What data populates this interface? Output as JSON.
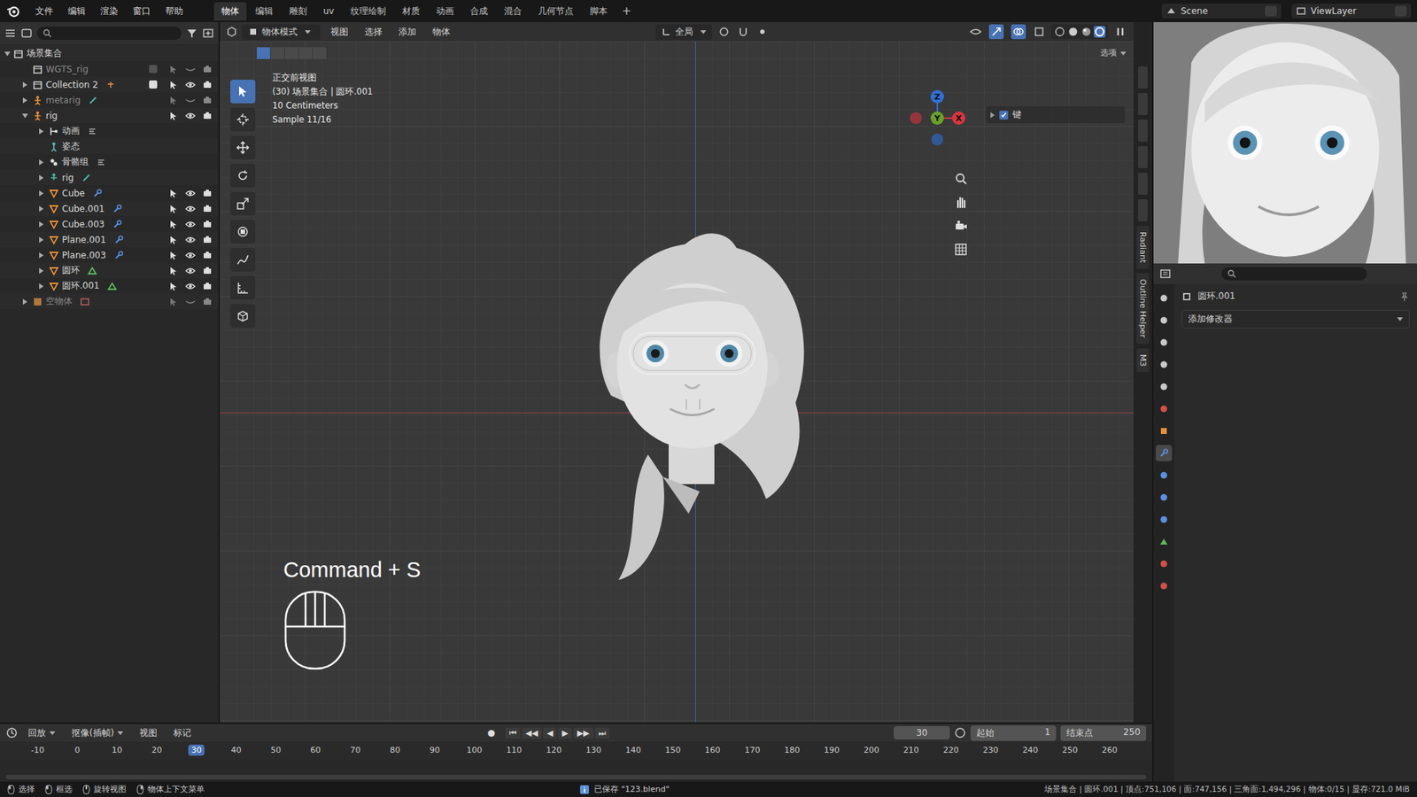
{
  "topbar": {
    "menus": [
      "文件",
      "编辑",
      "渲染",
      "窗口",
      "帮助"
    ],
    "workspaces": [
      {
        "label": "物体",
        "selected": true
      },
      {
        "label": "编辑",
        "selected": false
      },
      {
        "label": "雕刻",
        "selected": false
      },
      {
        "label": "uv",
        "selected": false
      },
      {
        "label": "纹理绘制",
        "selected": false
      },
      {
        "label": "材质",
        "selected": false
      },
      {
        "label": "动画",
        "selected": false
      },
      {
        "label": "合成",
        "selected": false
      },
      {
        "label": "混合",
        "selected": false
      },
      {
        "label": "几何节点",
        "selected": false
      },
      {
        "label": "脚本",
        "selected": false
      }
    ],
    "add_workspace": "+",
    "scene": "Scene",
    "view_layer": "ViewLayer"
  },
  "outliner": {
    "root": "场景集合",
    "items": [
      {
        "label": "WGTS_rig",
        "depth": 1,
        "has_children": false,
        "expanded": false,
        "kind": "collection",
        "disabled": true,
        "restrict": true,
        "visible": false,
        "checked": false,
        "sub_icon": "none"
      },
      {
        "label": "Collection 2",
        "depth": 1,
        "has_children": true,
        "expanded": false,
        "kind": "collection",
        "disabled": false,
        "restrict": true,
        "visible": true,
        "checked": true,
        "sub_icon": "armature"
      },
      {
        "label": "metarig",
        "depth": 1,
        "has_children": true,
        "expanded": false,
        "kind": "armature",
        "disabled": true,
        "restrict": true,
        "visible": false,
        "sub_icon": "bone"
      },
      {
        "label": "rig",
        "depth": 1,
        "has_children": true,
        "expanded": true,
        "kind": "armature",
        "disabled": false,
        "restrict": true,
        "visible": true,
        "sub_icon": "none"
      },
      {
        "label": "动画",
        "depth": 2,
        "has_children": true,
        "expanded": false,
        "kind": "anim",
        "disabled": false,
        "restrict": false,
        "visible": true,
        "sub_icon": "action"
      },
      {
        "label": "姿态",
        "depth": 2,
        "has_children": false,
        "expanded": false,
        "kind": "pose",
        "disabled": false,
        "restrict": false,
        "visible": true,
        "sub_icon": "none"
      },
      {
        "label": "骨骼组",
        "depth": 2,
        "has_children": true,
        "expanded": false,
        "kind": "bonegroup",
        "disabled": false,
        "restrict": false,
        "visible": true,
        "sub_icon": "action"
      },
      {
        "label": "rig",
        "depth": 2,
        "has_children": true,
        "expanded": false,
        "kind": "armdata",
        "disabled": false,
        "restrict": false,
        "visible": true,
        "sub_icon": "bone"
      },
      {
        "label": "Cube",
        "depth": 2,
        "has_children": true,
        "expanded": false,
        "kind": "mesh",
        "disabled": false,
        "restrict": true,
        "visible": true,
        "sub_icon": "modifier"
      },
      {
        "label": "Cube.001",
        "depth": 2,
        "has_children": true,
        "expanded": false,
        "kind": "mesh",
        "disabled": false,
        "restrict": true,
        "visible": true,
        "sub_icon": "modifier"
      },
      {
        "label": "Cube.003",
        "depth": 2,
        "has_children": true,
        "expanded": false,
        "kind": "mesh",
        "disabled": false,
        "restrict": true,
        "visible": true,
        "sub_icon": "modifier"
      },
      {
        "label": "Plane.001",
        "depth": 2,
        "has_children": true,
        "expanded": false,
        "kind": "mesh",
        "disabled": false,
        "restrict": true,
        "visible": true,
        "sub_icon": "modifier"
      },
      {
        "label": "Plane.003",
        "depth": 2,
        "has_children": true,
        "expanded": false,
        "kind": "mesh",
        "disabled": false,
        "restrict": true,
        "visible": true,
        "sub_icon": "modifier"
      },
      {
        "label": "圆环",
        "depth": 2,
        "has_children": true,
        "expanded": false,
        "kind": "mesh",
        "disabled": false,
        "restrict": true,
        "visible": true,
        "sub_icon": "mesh_data"
      },
      {
        "label": "圆环.001",
        "depth": 2,
        "has_children": true,
        "expanded": false,
        "kind": "mesh",
        "disabled": false,
        "restrict": true,
        "visible": true,
        "sub_icon": "mesh_data"
      },
      {
        "label": "空物体",
        "depth": 1,
        "has_children": true,
        "expanded": false,
        "kind": "empty",
        "disabled": true,
        "restrict": true,
        "visible": false,
        "sub_icon": "image"
      }
    ]
  },
  "viewport": {
    "mode": "物体模式",
    "menus": [
      "视图",
      "选择",
      "添加",
      "物体"
    ],
    "orientation": "全局",
    "options": "选项",
    "overlay_lines": [
      "正交前视图",
      "(30) 场景集合 | 圆环.001",
      "10 Centimeters",
      "Sample 11/16"
    ],
    "gizmo_axes": [
      {
        "label": "Z",
        "color": "#2f6fd6"
      },
      {
        "label": "Y",
        "color": "#6aa12a"
      },
      {
        "label": "X",
        "color": "#d6363f"
      }
    ],
    "panel": {
      "label": "键",
      "checked": true
    },
    "key_hint": "Command + S",
    "tools": [
      {
        "name": "select",
        "selected": true
      },
      {
        "name": "cursor",
        "selected": false
      },
      {
        "name": "move",
        "selected": false
      },
      {
        "name": "rotate",
        "selected": false
      },
      {
        "name": "scale",
        "selected": false
      },
      {
        "name": "transform",
        "selected": false
      },
      {
        "name": "annotate",
        "selected": false
      },
      {
        "name": "measure",
        "selected": false
      },
      {
        "name": "add-cube",
        "selected": false
      }
    ]
  },
  "sidebar_tabs": [
    "Radiant",
    "Outline Helper",
    "M3"
  ],
  "properties": {
    "object": "圆环.001",
    "add_modifier": "添加修改器",
    "tabs": [
      {
        "icon": "tool",
        "selected": false,
        "color": "#c8c8c8"
      },
      {
        "icon": "render",
        "selected": false,
        "color": "#c8c8c8"
      },
      {
        "icon": "output",
        "selected": false,
        "color": "#c8c8c8"
      },
      {
        "icon": "view-layer",
        "selected": false,
        "color": "#c8c8c8"
      },
      {
        "icon": "scene",
        "selected": false,
        "color": "#c8c8c8"
      },
      {
        "icon": "world",
        "selected": false,
        "color": "#d0504a"
      },
      {
        "icon": "object",
        "selected": false,
        "color": "#e6903a"
      },
      {
        "icon": "modifier",
        "selected": true,
        "color": "#5c8fe0"
      },
      {
        "icon": "particles",
        "selected": false,
        "color": "#5c8fe0"
      },
      {
        "icon": "physics",
        "selected": false,
        "color": "#5c8fe0"
      },
      {
        "icon": "constraints",
        "selected": false,
        "color": "#5c8fe0"
      },
      {
        "icon": "data",
        "selected": false,
        "color": "#5cb85c"
      },
      {
        "icon": "material",
        "selected": false,
        "color": "#d0504a"
      },
      {
        "icon": "texture",
        "selected": false,
        "color": "#d0504a"
      }
    ]
  },
  "timeline": {
    "menus": [
      "回放",
      "抠像(插帧)",
      "视图",
      "标记"
    ],
    "record": "●",
    "transport": [
      "⏮",
      "◀◀",
      "◀",
      "▶",
      "▶▶",
      "⏭"
    ],
    "current": "30",
    "start_label": "起始",
    "start": "1",
    "end_label": "结束点",
    "end": "250",
    "frames": [
      {
        "label": "-10",
        "selected": false
      },
      {
        "label": "0",
        "selected": false
      },
      {
        "label": "10",
        "selected": false
      },
      {
        "label": "20",
        "selected": false
      },
      {
        "label": "30",
        "selected": true
      },
      {
        "label": "40",
        "selected": false
      },
      {
        "label": "50",
        "selected": false
      },
      {
        "label": "60",
        "selected": false
      },
      {
        "label": "70",
        "selected": false
      },
      {
        "label": "80",
        "selected": false
      },
      {
        "label": "90",
        "selected": false
      },
      {
        "label": "100",
        "selected": false
      },
      {
        "label": "110",
        "selected": false
      },
      {
        "label": "120",
        "selected": false
      },
      {
        "label": "130",
        "selected": false
      },
      {
        "label": "140",
        "selected": false
      },
      {
        "label": "150",
        "selected": false
      },
      {
        "label": "160",
        "selected": false
      },
      {
        "label": "170",
        "selected": false
      },
      {
        "label": "180",
        "selected": false
      },
      {
        "label": "190",
        "selected": false
      },
      {
        "label": "200",
        "selected": false
      },
      {
        "label": "210",
        "selected": false
      },
      {
        "label": "220",
        "selected": false
      },
      {
        "label": "230",
        "selected": false
      },
      {
        "label": "240",
        "selected": false
      },
      {
        "label": "250",
        "selected": false
      },
      {
        "label": "260",
        "selected": false
      }
    ]
  },
  "status_bar": {
    "hints": [
      "选择",
      "框选",
      "旋转视图",
      "物体上下文菜单"
    ],
    "message": "已保存 \"123.blend\"",
    "stats": "场景集合 | 圆环.001 | 顶点:751,106 | 面:747,156 | 三角面:1,494,296 | 物体:0/15 | 显存:721.0 MiB"
  }
}
